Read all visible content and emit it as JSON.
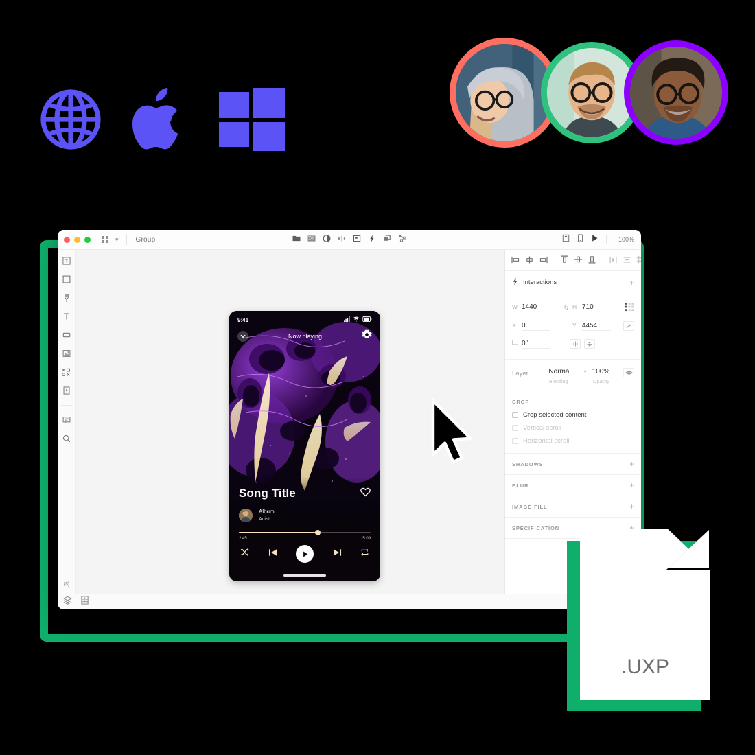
{
  "platform_icons": [
    {
      "name": "globe-icon",
      "label": "Web",
      "color": "#5B53F5"
    },
    {
      "name": "apple-icon",
      "label": "macOS",
      "color": "#5B53F5"
    },
    {
      "name": "windows-icon",
      "label": "Windows",
      "color": "#5B53F5"
    }
  ],
  "avatars": [
    {
      "name": "avatar-1",
      "ring_color": "#FF6F61"
    },
    {
      "name": "avatar-2",
      "ring_color": "#2EC27E"
    },
    {
      "name": "avatar-3",
      "ring_color": "#8B00FF"
    }
  ],
  "accent": {
    "green": "#0FAE6A",
    "indigo": "#5B53F5"
  },
  "window": {
    "titlebar": {
      "title": "Group",
      "zoom": "100%",
      "grid_icon": "grid-icon",
      "caret_icon": "chevron-down-icon",
      "center_tools": [
        "folder-icon",
        "grid-pattern-icon",
        "mask-icon",
        "distribute-icon",
        "component-icon",
        "interaction-bolt-icon",
        "duplicate-icon",
        "symbol-icon"
      ],
      "right_tools": [
        "export-icon",
        "device-preview-icon",
        "play-icon"
      ]
    },
    "toolbar_left": [
      "artboard-icon",
      "rectangle-icon",
      "pen-icon",
      "text-icon",
      "shape-icon",
      "image-icon",
      "boolean-icon",
      "component-add-icon",
      "comment-icon",
      "search-icon"
    ],
    "toolbar_left_bottom": [
      "token-icon"
    ],
    "statusbar": [
      "layers-icon",
      "assets-icon"
    ]
  },
  "phone": {
    "status": {
      "time": "9:41",
      "signal": "signal-icon",
      "wifi": "wifi-icon",
      "battery": "battery-icon"
    },
    "nav": {
      "collapse_icon": "chevron-down-icon",
      "title": "Now playing",
      "settings_icon": "gear-icon"
    },
    "song": {
      "title": "Song Title",
      "like_icon": "heart-icon",
      "album": "Album",
      "artist": "Artist",
      "elapsed": "2:45",
      "duration": "5:09",
      "progress_percent": 60
    },
    "controls": {
      "shuffle_icon": "shuffle-icon",
      "previous_icon": "skip-previous-icon",
      "play_icon": "play-icon",
      "next_icon": "skip-next-icon",
      "repeat_icon": "repeat-icon",
      "accent_color": "#F2E3BC"
    }
  },
  "inspector": {
    "align_left_group": [
      "align-left-icon",
      "align-center-horizontal-icon",
      "align-right-icon"
    ],
    "align_mid_group": [
      "align-top-icon",
      "align-middle-vertical-icon",
      "align-bottom-icon"
    ],
    "align_right_group": [
      "distribute-horizontal-icon",
      "distribute-vertical-icon",
      "grid-distribute-icon"
    ],
    "interactions": {
      "label": "Interactions",
      "icon": "bolt-icon",
      "add": "+"
    },
    "dimensions": {
      "w_key": "W",
      "w_value": "1440",
      "link_icon": "link-icon",
      "h_key": "H",
      "h_value": "710",
      "grid_icon": "layout-grid-icon",
      "x_key": "X",
      "x_value": "0",
      "y_key": "Y",
      "y_value": "4454",
      "responsive_icon": "responsive-resize-icon",
      "angle_key": "angle-icon",
      "angle_value": "0°",
      "flip_h_icon": "flip-horizontal-icon",
      "flip_v_icon": "flip-vertical-icon"
    },
    "layer": {
      "label": "Layer",
      "blending_value": "Normal",
      "blending_caption": "Blending",
      "opacity_value": "100%",
      "opacity_caption": "Opacity",
      "eye_icon": "eye-icon",
      "caret_icon": "chevron-down-icon"
    },
    "crop": {
      "heading": "CROP",
      "options": [
        {
          "label": "Crop selected content",
          "checked": false,
          "disabled": false
        },
        {
          "label": "Vertical scroll",
          "checked": false,
          "disabled": true
        },
        {
          "label": "Horizontal scroll",
          "checked": false,
          "disabled": true
        }
      ]
    },
    "sections": [
      {
        "heading": "SHADOWS",
        "add": "+"
      },
      {
        "heading": "BLUR",
        "add": "+"
      },
      {
        "heading": "IMAGE FILL",
        "add": "+"
      },
      {
        "heading": "SPECIFICATION",
        "add": "+"
      }
    ]
  },
  "file_badge": {
    "extension": ".UXP",
    "color": "#0FAE6A"
  },
  "cursor": {
    "name": "mouse-pointer-icon"
  }
}
